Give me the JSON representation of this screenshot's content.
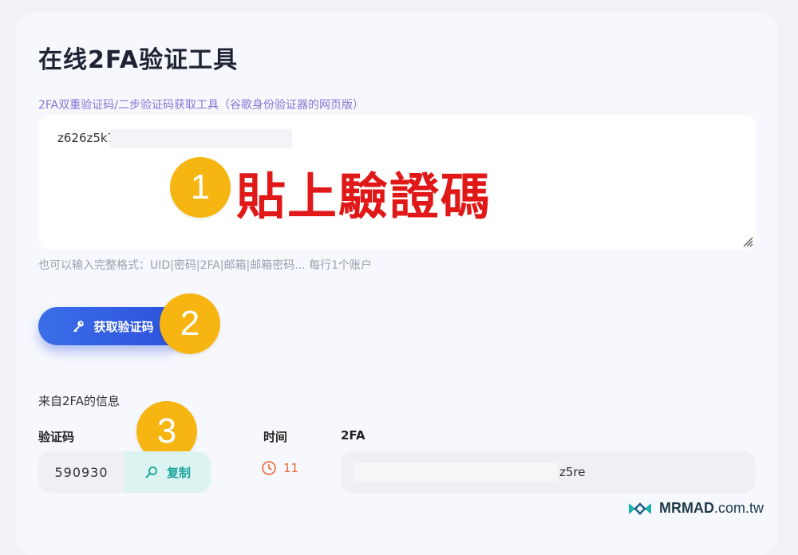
{
  "page": {
    "title": "在线2FA验证工具",
    "subtitle": "2FA双重验证码/二步验证码获取工具（谷歌身份验证器的网页版）"
  },
  "input": {
    "value": "z626z5k7",
    "hint": "也可以输入完整格式：UID|密码|2FA|邮箱|邮箱密码... 每行1个账户"
  },
  "annotations": {
    "step1": "1",
    "step1_label": "貼上驗證碼",
    "step2": "2",
    "step3": "3"
  },
  "actions": {
    "get_code_label": "获取验证码"
  },
  "result": {
    "section_title": "来自2FA的信息",
    "columns": {
      "code": "验证码",
      "time": "时间",
      "twofa": "2FA"
    },
    "code_value": "590930",
    "copy_label": "复制",
    "time_value": "11",
    "twofa_value": "z5re"
  },
  "branding": {
    "logo_bold": "MRMAD",
    "logo_suffix": ".com.tw"
  },
  "icons": {
    "key": "key-icon",
    "search": "search-icon",
    "clock": "clock-icon",
    "resize": "resize-handle-icon",
    "logo": "mrmad-logo-icon"
  },
  "colors": {
    "accent_blue": "#2b50db",
    "step_badge": "#f7b512",
    "annotation_red": "#e01818",
    "copy_teal": "#1aa59a",
    "timer_orange": "#e96a3b",
    "subtitle_purple": "#8a73d6"
  }
}
